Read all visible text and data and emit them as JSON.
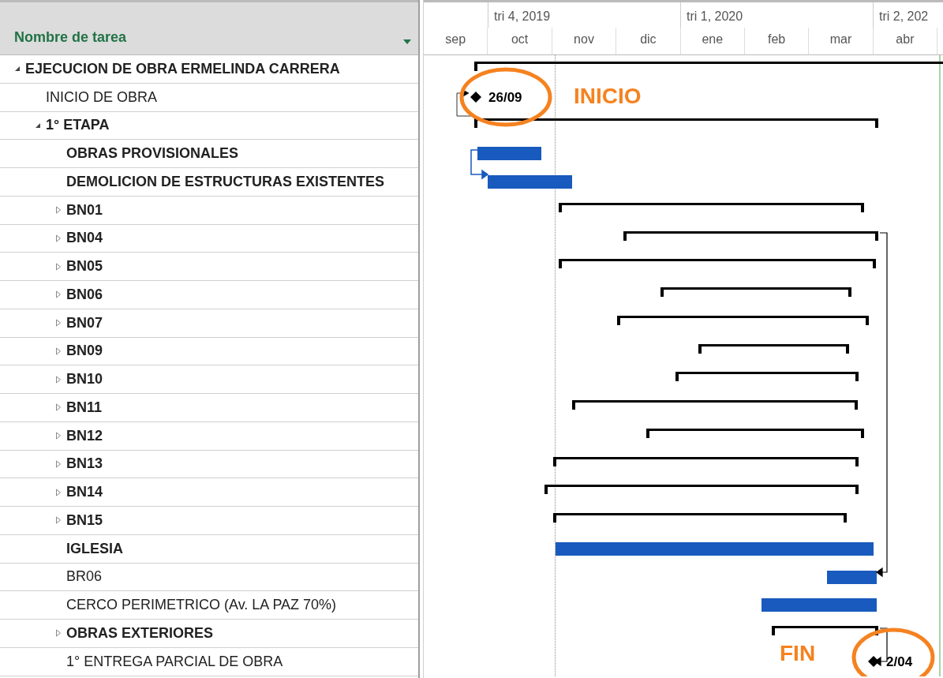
{
  "table": {
    "column_header": "Nombre de tarea"
  },
  "timescale": {
    "quarters": [
      "tri 4, 2019",
      "tri 1, 2020",
      "tri 2, 202"
    ],
    "months": [
      "sep",
      "oct",
      "nov",
      "dic",
      "ene",
      "feb",
      "mar",
      "abr"
    ]
  },
  "tasks": [
    {
      "name": "EJECUCION DE OBRA ERMELINDA CARRERA",
      "bold": true,
      "expanded": true,
      "bar": {
        "kind": "summary"
      },
      "children": [
        {
          "name": "INICIO DE OBRA",
          "bold": false,
          "bar": {
            "kind": "milestone",
            "label": "26/09"
          }
        },
        {
          "name": "1° ETAPA",
          "bold": true,
          "expanded": true,
          "bar": {
            "kind": "summary"
          },
          "children": [
            {
              "name": "OBRAS PROVISIONALES",
              "bold": true,
              "bar": {
                "kind": "task"
              }
            },
            {
              "name": "DEMOLICION DE ESTRUCTURAS EXISTENTES",
              "bold": true,
              "bar": {
                "kind": "task"
              }
            },
            {
              "name": "BN01",
              "bold": true,
              "expanded": false,
              "bar": {
                "kind": "summary"
              }
            },
            {
              "name": "BN04",
              "bold": true,
              "expanded": false,
              "bar": {
                "kind": "summary"
              }
            },
            {
              "name": "BN05",
              "bold": true,
              "expanded": false,
              "bar": {
                "kind": "summary"
              }
            },
            {
              "name": "BN06",
              "bold": true,
              "expanded": false,
              "bar": {
                "kind": "summary"
              }
            },
            {
              "name": "BN07",
              "bold": true,
              "expanded": false,
              "bar": {
                "kind": "summary"
              }
            },
            {
              "name": "BN09",
              "bold": true,
              "expanded": false,
              "bar": {
                "kind": "summary"
              }
            },
            {
              "name": "BN10",
              "bold": true,
              "expanded": false,
              "bar": {
                "kind": "summary"
              }
            },
            {
              "name": "BN11",
              "bold": true,
              "expanded": false,
              "bar": {
                "kind": "summary"
              }
            },
            {
              "name": "BN12",
              "bold": true,
              "expanded": false,
              "bar": {
                "kind": "summary"
              }
            },
            {
              "name": "BN13",
              "bold": true,
              "expanded": false,
              "bar": {
                "kind": "summary"
              }
            },
            {
              "name": "BN14",
              "bold": true,
              "expanded": false,
              "bar": {
                "kind": "summary"
              }
            },
            {
              "name": "BN15",
              "bold": true,
              "expanded": false,
              "bar": {
                "kind": "summary"
              }
            },
            {
              "name": "IGLESIA",
              "bold": true,
              "bar": {
                "kind": "task"
              }
            },
            {
              "name": "BR06",
              "bold": false,
              "bar": {
                "kind": "task"
              }
            },
            {
              "name": "CERCO PERIMETRICO (Av. LA PAZ 70%)",
              "bold": false,
              "bar": {
                "kind": "task"
              }
            },
            {
              "name": "OBRAS EXTERIORES",
              "bold": true,
              "expanded": false,
              "bar": {
                "kind": "summary"
              }
            },
            {
              "name": "1° ENTREGA PARCIAL DE OBRA",
              "bold": false,
              "bar": {
                "kind": "milestone",
                "label": "2/04"
              }
            }
          ]
        }
      ]
    }
  ],
  "annotations": [
    "INICIO",
    "FIN"
  ]
}
